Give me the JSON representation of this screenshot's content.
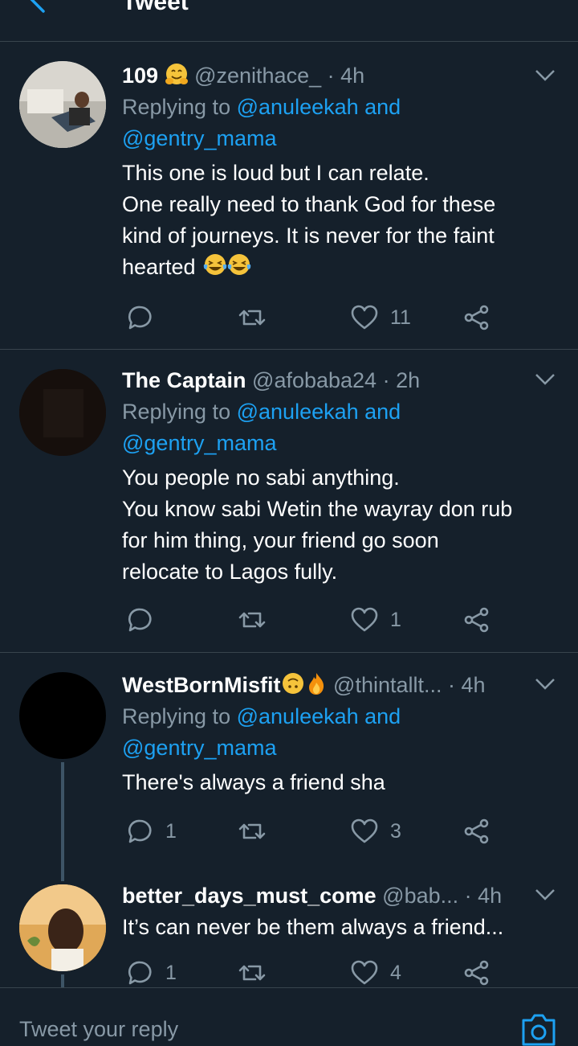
{
  "header": {
    "title": "Tweet"
  },
  "tweets": [
    {
      "name": "109",
      "handle": "@zenithace_",
      "time": "· 4h",
      "replying_prefix": "Replying to",
      "replying_to_1": "@anuleekah and",
      "replying_to_2": "@gentry_mama",
      "lines": [
        "This one is loud but I can relate.",
        "One really need to thank God for these",
        "kind of journeys. It is never for the faint",
        "hearted"
      ],
      "reply_count": "",
      "retweet_count": "",
      "like_count": "11"
    },
    {
      "name": "The Captain",
      "handle": "@afobaba24",
      "time": "· 2h",
      "replying_prefix": "Replying to",
      "replying_to_1": "@anuleekah and",
      "replying_to_2": "@gentry_mama",
      "lines": [
        "You people no sabi anything.",
        "You know sabi Wetin the wayray don rub",
        "for him thing, your friend go soon",
        "relocate to Lagos fully."
      ],
      "reply_count": "",
      "retweet_count": "",
      "like_count": "1"
    },
    {
      "name": "WestBornMisfit",
      "handle": "@thintallt...",
      "time": "· 4h",
      "replying_prefix": "Replying to",
      "replying_to_1": "@anuleekah and",
      "replying_to_2": "@gentry_mama",
      "lines": [
        "There's always a friend sha"
      ],
      "reply_count": "1",
      "retweet_count": "",
      "like_count": "3"
    },
    {
      "name": "better_days_must_come",
      "handle": "@bab...",
      "time": "· 4h",
      "lines": [
        "It’s can never be them always a friend..."
      ],
      "reply_count": "1",
      "retweet_count": "",
      "like_count": "4"
    }
  ],
  "reply_bar": {
    "placeholder": "Tweet your reply"
  },
  "colors": {
    "background": "#15202b",
    "accent": "#1da1f2",
    "secondary_text": "#8899a6",
    "divider": "#38444d"
  },
  "icons": [
    "back-arrow-icon",
    "chevron-down-icon",
    "reply-icon",
    "retweet-icon",
    "like-icon",
    "share-icon",
    "camera-icon"
  ]
}
